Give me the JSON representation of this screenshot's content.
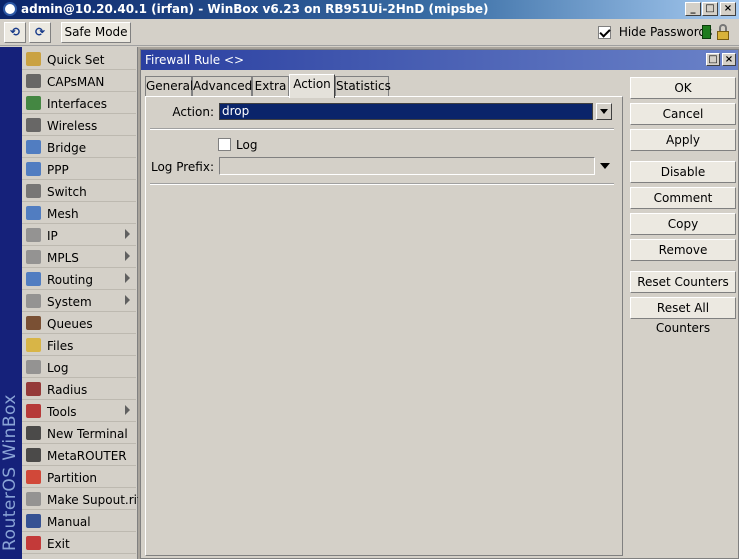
{
  "window": {
    "title": "admin@10.20.40.1 (irfan) - WinBox v6.23 on RB951Ui-2HnD (mipsbe)",
    "minimize_icon": "_",
    "maximize_icon": "□",
    "close_icon": "×"
  },
  "toolbar": {
    "undo_icon": "⟲",
    "redo_icon": "⟳",
    "safe_mode_label": "Safe Mode",
    "hide_passwords_label": "Hide Passwords",
    "hide_passwords_checked": true
  },
  "brand": {
    "vertical_text": "RouterOS WinBox"
  },
  "sidebar": {
    "items": [
      {
        "label": "Quick Set",
        "icon": "quick-set-icon",
        "submenu": false
      },
      {
        "label": "CAPsMAN",
        "icon": "capsman-icon",
        "submenu": false
      },
      {
        "label": "Interfaces",
        "icon": "interfaces-icon",
        "submenu": false
      },
      {
        "label": "Wireless",
        "icon": "wireless-icon",
        "submenu": false
      },
      {
        "label": "Bridge",
        "icon": "bridge-icon",
        "submenu": false
      },
      {
        "label": "PPP",
        "icon": "ppp-icon",
        "submenu": false
      },
      {
        "label": "Switch",
        "icon": "switch-icon",
        "submenu": false
      },
      {
        "label": "Mesh",
        "icon": "mesh-icon",
        "submenu": false
      },
      {
        "label": "IP",
        "icon": "ip-icon",
        "submenu": true
      },
      {
        "label": "MPLS",
        "icon": "mpls-icon",
        "submenu": true
      },
      {
        "label": "Routing",
        "icon": "routing-icon",
        "submenu": true
      },
      {
        "label": "System",
        "icon": "system-icon",
        "submenu": true
      },
      {
        "label": "Queues",
        "icon": "queues-icon",
        "submenu": false
      },
      {
        "label": "Files",
        "icon": "files-icon",
        "submenu": false
      },
      {
        "label": "Log",
        "icon": "log-icon",
        "submenu": false
      },
      {
        "label": "Radius",
        "icon": "radius-icon",
        "submenu": false
      },
      {
        "label": "Tools",
        "icon": "tools-icon",
        "submenu": true
      },
      {
        "label": "New Terminal",
        "icon": "terminal-icon",
        "submenu": false
      },
      {
        "label": "MetaROUTER",
        "icon": "metarouter-icon",
        "submenu": false
      },
      {
        "label": "Partition",
        "icon": "partition-icon",
        "submenu": false
      },
      {
        "label": "Make Supout.rif",
        "icon": "supout-icon",
        "submenu": false
      },
      {
        "label": "Manual",
        "icon": "manual-icon",
        "submenu": false
      },
      {
        "label": "Exit",
        "icon": "exit-icon",
        "submenu": false
      }
    ]
  },
  "dialog": {
    "title": "Firewall Rule <>",
    "tabs": [
      {
        "label": "General",
        "active": false
      },
      {
        "label": "Advanced",
        "active": false
      },
      {
        "label": "Extra",
        "active": false
      },
      {
        "label": "Action",
        "active": true
      },
      {
        "label": "Statistics",
        "active": false
      }
    ],
    "action_label": "Action:",
    "action_value": "drop",
    "log_label": "Log",
    "log_checked": false,
    "log_prefix_label": "Log Prefix:",
    "log_prefix_value": "",
    "buttons": {
      "ok": "OK",
      "cancel": "Cancel",
      "apply": "Apply",
      "disable": "Disable",
      "comment": "Comment",
      "copy": "Copy",
      "remove": "Remove",
      "reset_counters": "Reset Counters",
      "reset_all_counters": "Reset All Counters"
    }
  },
  "colors": {
    "selection": "#0a246a",
    "brand_strip": "#15217a",
    "dialog_title": "#2a3fa0",
    "window_face": "#d4d0c8"
  }
}
